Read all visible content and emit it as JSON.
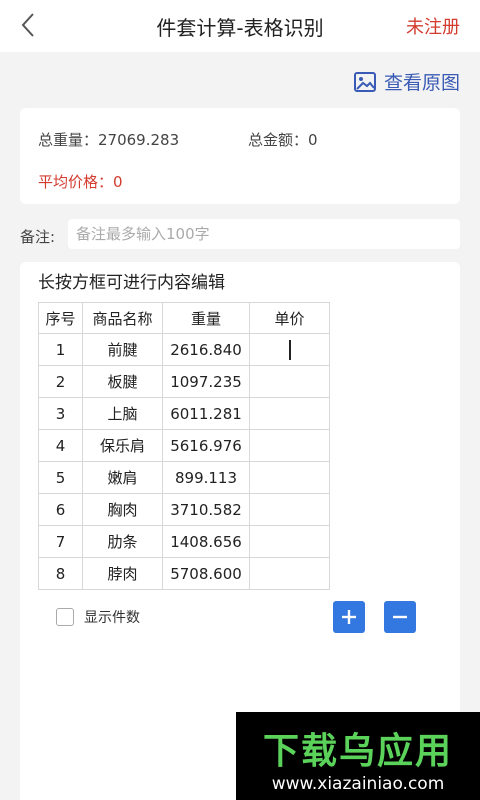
{
  "header": {
    "title": "件套计算-表格识别",
    "register_label": "未注册"
  },
  "toolbar": {
    "view_original_label": "查看原图"
  },
  "summary": {
    "total_weight": "总重量：27069.283",
    "total_amount": "总金额：0",
    "average_price": "平均价格：0"
  },
  "remark": {
    "label": "备注:",
    "placeholder": "备注最多输入100字",
    "value": ""
  },
  "table": {
    "hint": "长按方框可进行内容编辑",
    "headers": [
      "序号",
      "商品名称",
      "重量",
      "单价"
    ],
    "rows": [
      {
        "idx": "1",
        "name": "前腱",
        "weight": "2616.840",
        "price": ""
      },
      {
        "idx": "2",
        "name": "板腱",
        "weight": "1097.235",
        "price": ""
      },
      {
        "idx": "3",
        "name": "上脑",
        "weight": "6011.281",
        "price": ""
      },
      {
        "idx": "4",
        "name": "保乐肩",
        "weight": "5616.976",
        "price": ""
      },
      {
        "idx": "5",
        "name": "嫩肩",
        "weight": "899.113",
        "price": ""
      },
      {
        "idx": "6",
        "name": "胸肉",
        "weight": "3710.582",
        "price": ""
      },
      {
        "idx": "7",
        "name": "肋条",
        "weight": "1408.656",
        "price": ""
      },
      {
        "idx": "8",
        "name": "脖肉",
        "weight": "5708.600",
        "price": ""
      }
    ]
  },
  "controls": {
    "show_count_label": "显示件数",
    "add_label": "+",
    "remove_label": "−"
  },
  "watermark": {
    "logo_text": "下载乌应用",
    "url": "www.xiazainiao.com"
  },
  "colors": {
    "accent_blue": "#3377e0",
    "link_blue": "#3a5bb5",
    "alert_red": "#d23b2e"
  }
}
